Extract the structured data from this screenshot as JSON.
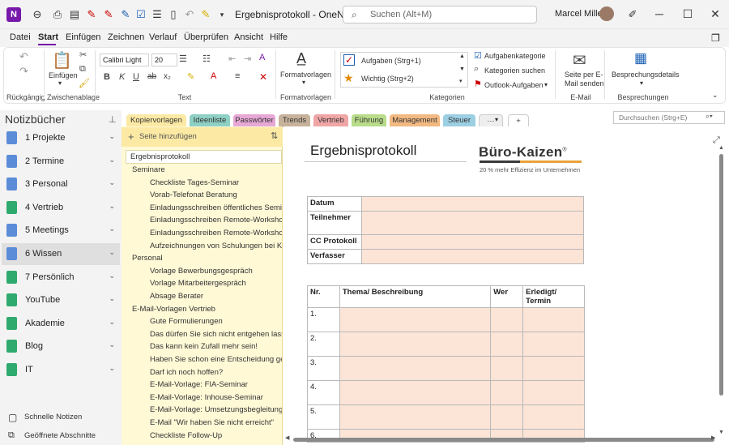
{
  "window": {
    "doc_title": "Ergebnisprotokoll - OneNote",
    "search_placeholder": "Suchen (Alt+M)",
    "user_name": "Marcel Miller",
    "app_badge": "N"
  },
  "menu": [
    "Datei",
    "Start",
    "Einfügen",
    "Zeichnen",
    "Verlauf",
    "Überprüfen",
    "Ansicht",
    "Hilfe"
  ],
  "ribbon": {
    "undo_group": "Rückgängig",
    "paste_label": "Einfügen",
    "clipboard_group": "Zwischenablage",
    "font_name": "Calibri Light",
    "font_size": "20",
    "text_group": "Text",
    "styles_label": "Formatvorlagen",
    "styles_group": "Formatvorlagen",
    "tag1": "Aufgaben (Strg+1)",
    "tag2": "Wichtig (Strg+2)",
    "tag_category": "Aufgabenkategorie",
    "find_category": "Kategorien suchen",
    "outlook_tasks": "Outlook-Aufgaben",
    "categories_group": "Kategorien",
    "email_page_l1": "Seite per E-",
    "email_page_l2": "Mail senden",
    "email_group": "E-Mail",
    "meeting_details": "Besprechungsdetails",
    "meetings_group": "Besprechungen"
  },
  "notebooks": {
    "header": "Notizbücher",
    "items": [
      {
        "label": "1 Projekte",
        "color": "#5b8cd8"
      },
      {
        "label": "2 Termine",
        "color": "#5b8cd8"
      },
      {
        "label": "3 Personal",
        "color": "#5b8cd8"
      },
      {
        "label": "4 Vertrieb",
        "color": "#2faa6e"
      },
      {
        "label": "5 Meetings",
        "color": "#5b8cd8"
      },
      {
        "label": "6 Wissen",
        "color": "#5b8cd8"
      },
      {
        "label": "7 Persönlich",
        "color": "#2faa6e"
      },
      {
        "label": "YouTube",
        "color": "#2faa6e"
      },
      {
        "label": "Akademie",
        "color": "#2faa6e"
      },
      {
        "label": "Blog",
        "color": "#2faa6e"
      },
      {
        "label": "IT",
        "color": "#2faa6e"
      }
    ],
    "quick_notes": "Schnelle Notizen",
    "open_sections": "Geöffnete Abschnitte"
  },
  "sections": [
    {
      "label": "Kopiervorlagen",
      "color": "#fce9a4"
    },
    {
      "label": "Ideenliste",
      "color": "#8fd0c5"
    },
    {
      "label": "Passwörter",
      "color": "#e7a8d6"
    },
    {
      "label": "Trends",
      "color": "#c7b39b"
    },
    {
      "label": "Vertrieb",
      "color": "#f0a6a6"
    },
    {
      "label": "Führung",
      "color": "#b8dc8a"
    },
    {
      "label": "Management",
      "color": "#f2b982"
    },
    {
      "label": "Steuer",
      "color": "#9dcfe3"
    }
  ],
  "section_more": "···",
  "section_add": "+",
  "nb_search_placeholder": "Durchsuchen (Strg+E)",
  "pages": {
    "add_label": "Seite hinzufügen",
    "current": "Ergebnisprotokoll",
    "rows": [
      {
        "text": "Seminare",
        "lvl": 0
      },
      {
        "text": "Checkliste Tages-Seminar",
        "lvl": 1
      },
      {
        "text": "Vorab-Telefonat Beratung",
        "lvl": 1
      },
      {
        "text": "Einladungsschreiben öffentliches Seminar",
        "lvl": 1
      },
      {
        "text": "Einladungsschreiben Remote-Workshop",
        "lvl": 1
      },
      {
        "text": "Einladungsschreiben Remote-Workshop",
        "lvl": 1
      },
      {
        "text": "Aufzeichnungen von Schulungen bei Kun",
        "lvl": 1
      },
      {
        "text": "Personal",
        "lvl": 0
      },
      {
        "text": "Vorlage Bewerbungsgespräch",
        "lvl": 1
      },
      {
        "text": "Vorlage Mitarbeitergespräch",
        "lvl": 1
      },
      {
        "text": "Absage Berater",
        "lvl": 1
      },
      {
        "text": "E-Mail-Vorlagen Vertrieb",
        "lvl": 0
      },
      {
        "text": "Gute Formulierungen",
        "lvl": 1
      },
      {
        "text": "Das dürfen Sie sich nicht entgehen lassen",
        "lvl": 1
      },
      {
        "text": "Das kann kein Zufall mehr sein!",
        "lvl": 1
      },
      {
        "text": "Haben Sie schon eine Entscheidung getro",
        "lvl": 1
      },
      {
        "text": "Darf ich noch hoffen?",
        "lvl": 1
      },
      {
        "text": "E-Mail-Vorlage: FIA-Seminar",
        "lvl": 1
      },
      {
        "text": "E-Mail-Vorlage: Inhouse-Seminar",
        "lvl": 1
      },
      {
        "text": "E-Mail-Vorlage: Umsetzungsbegleitung",
        "lvl": 1
      },
      {
        "text": "E-Mail \"Wir haben Sie nicht erreicht\"",
        "lvl": 1
      },
      {
        "text": "Checkliste Follow-Up",
        "lvl": 1
      }
    ]
  },
  "page": {
    "title": "Ergebnisprotokoll",
    "logo": "Büro-Kaizen",
    "logo_reg": "®",
    "logo_sub": "20 % mehr Effizienz im Unternehmen",
    "info_rows": [
      "Datum",
      "Teilnehmer",
      "CC Protokoll",
      "Verfasser"
    ],
    "task_headers": [
      "Nr.",
      "Thema/ Beschreibung",
      "Wer",
      "Erledigt/ Termin"
    ],
    "task_numbers": [
      "1.",
      "2.",
      "3.",
      "4.",
      "5.",
      "6."
    ]
  }
}
